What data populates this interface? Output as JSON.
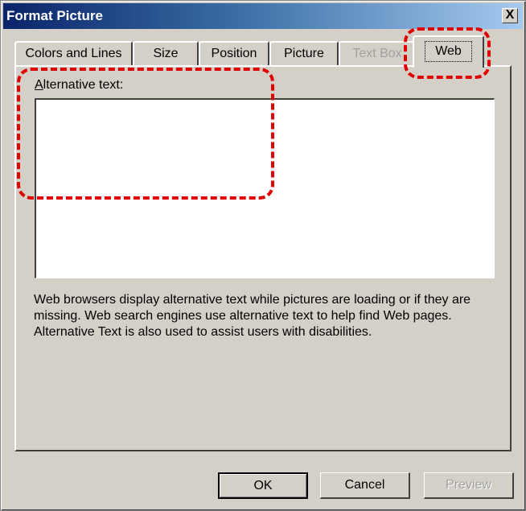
{
  "window": {
    "title": "Format Picture",
    "close_label": "X"
  },
  "tabs": [
    {
      "label": "Colors and Lines",
      "state": "normal"
    },
    {
      "label": "Size",
      "state": "normal"
    },
    {
      "label": "Position",
      "state": "normal"
    },
    {
      "label": "Picture",
      "state": "normal"
    },
    {
      "label": "Text Box",
      "state": "disabled"
    },
    {
      "label": "Web",
      "state": "active"
    }
  ],
  "web_tab": {
    "alt_text_label_mnemonic": "A",
    "alt_text_label_rest": "lternative text:",
    "alt_text_value": "",
    "help_text": "Web browsers display alternative text while pictures are loading or if they are missing.   Web search engines use alternative text to help find Web pages.  Alternative Text is also used to assist users with disabilities."
  },
  "buttons": {
    "ok": "OK",
    "cancel": "Cancel",
    "preview": "Preview"
  },
  "annotation": {
    "color": "#e00000"
  }
}
